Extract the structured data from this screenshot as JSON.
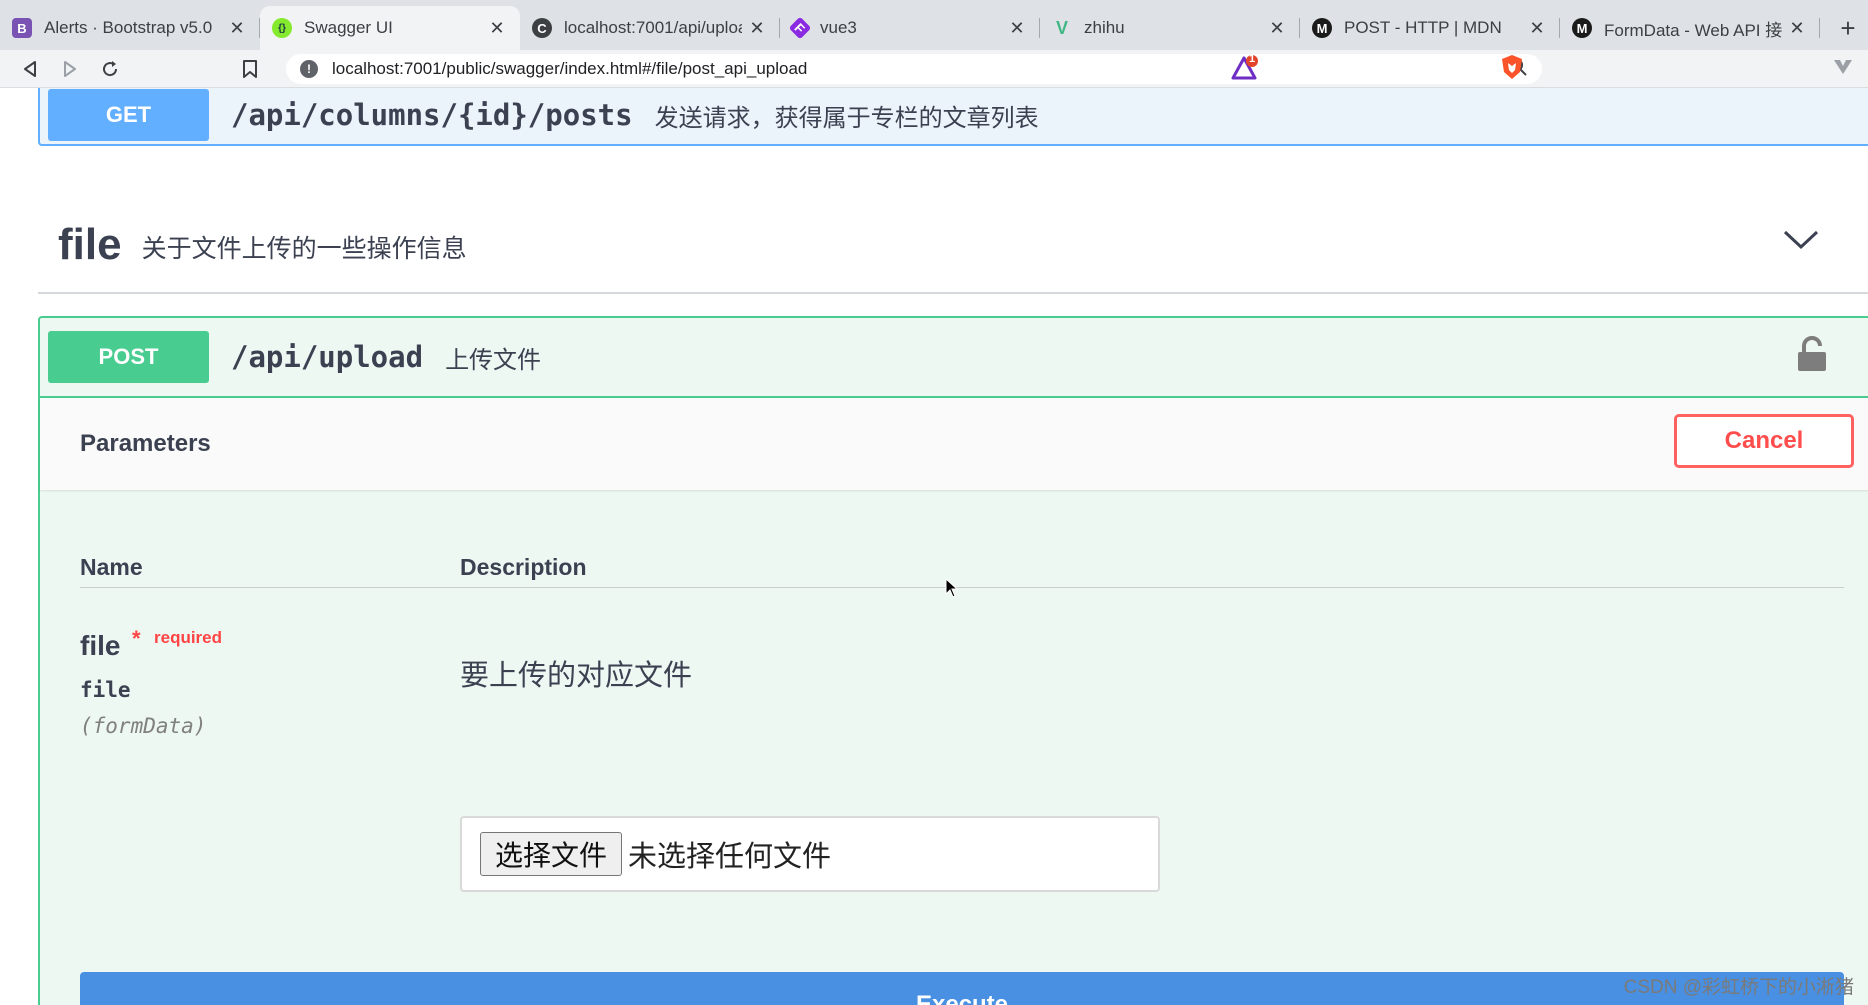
{
  "browser": {
    "tabs": [
      {
        "title": "Alerts · Bootstrap v5.0",
        "favicon": "bootstrap-icon",
        "favicon_color": "#7952b3",
        "favicon_glyph": "B"
      },
      {
        "title": "Swagger UI",
        "favicon": "swagger-icon",
        "favicon_color": "#85ea2d",
        "favicon_glyph": "{}",
        "active": true
      },
      {
        "title": "localhost:7001/api/uploa",
        "favicon": "globe-icon",
        "favicon_color": "#3c4043",
        "favicon_glyph": "C"
      },
      {
        "title": "vue3",
        "favicon": "vue-form-icon",
        "favicon_color": "#8a2be2",
        "favicon_glyph": "F"
      },
      {
        "title": "zhihu",
        "favicon": "vue-icon",
        "favicon_color": "#41b883",
        "favicon_glyph": "V"
      },
      {
        "title": "POST - HTTP | MDN",
        "favicon": "mdn-icon",
        "favicon_color": "#1b1b1b",
        "favicon_glyph": "M"
      },
      {
        "title": "FormData - Web API 接口",
        "favicon": "mdn-icon",
        "favicon_color": "#1b1b1b",
        "favicon_glyph": "M"
      }
    ],
    "url": "localhost:7001/public/swagger/index.html#/file/post_api_upload",
    "shield_badge": "1"
  },
  "swagger": {
    "get_op": {
      "method": "GET",
      "path": "/api/columns/{id}/posts",
      "summary": "发送请求，获得属于专栏的文章列表"
    },
    "tag": {
      "name": "file",
      "description": "关于文件上传的一些操作信息"
    },
    "post_op": {
      "method": "POST",
      "path": "/api/upload",
      "summary": "上传文件",
      "parameters_title": "Parameters",
      "cancel_label": "Cancel",
      "columns": {
        "name": "Name",
        "description": "Description"
      },
      "param": {
        "name": "file",
        "star": "*",
        "required": "required",
        "type": "file",
        "in": "(formData)",
        "description": "要上传的对应文件",
        "file_button": "选择文件",
        "file_status": "未选择任何文件"
      },
      "execute_label": "Execute"
    }
  },
  "watermark": "CSDN @彩虹桥下的小淅猪",
  "colors": {
    "get": "#61affe",
    "post": "#49cc90",
    "execute": "#4990e2",
    "cancel": "#ff4d4d"
  }
}
